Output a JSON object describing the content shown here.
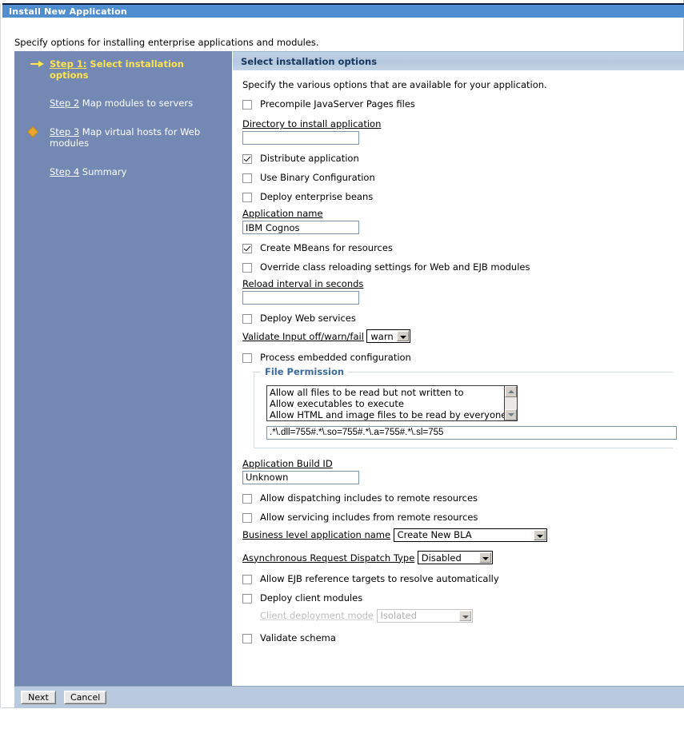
{
  "window": {
    "title": "Install New Application"
  },
  "intro": "Specify options for installing enterprise applications and modules.",
  "sidebar": {
    "steps": [
      {
        "label": "Step 1:",
        "text": " Select installation options",
        "marker": "arrow-right-icon",
        "state": "active"
      },
      {
        "label": "Step 2",
        "text": " Map modules to servers",
        "marker": "none",
        "state": "link"
      },
      {
        "label": "Step 3",
        "text": " Map virtual hosts for Web modules",
        "marker": "diamond-icon",
        "state": "link"
      },
      {
        "label": "Step 4",
        "text": " Summary",
        "marker": "none",
        "state": "link"
      }
    ]
  },
  "content": {
    "header": "Select installation options",
    "description": "Specify the various options that are available for your application.",
    "options": {
      "precompile_jsp": "Precompile JavaServer Pages files",
      "directory_label": "Directory to install application",
      "directory_value": "",
      "distribute_application": "Distribute application",
      "use_binary_configuration": "Use Binary Configuration",
      "deploy_enterprise_beans": "Deploy enterprise beans",
      "application_name_label": "Application name",
      "application_name_value": "IBM Cognos",
      "create_mbeans": "Create MBeans for resources",
      "override_class_reloading": "Override class reloading settings for Web and EJB modules",
      "reload_interval_label": "Reload interval in seconds",
      "reload_interval_value": "",
      "deploy_web_services": "Deploy Web services",
      "validate_input_label": "Validate Input off/warn/fail",
      "validate_input_value": "warn",
      "process_embedded_configuration": "Process embedded configuration",
      "application_build_id_label": "Application Build ID",
      "application_build_id_value": "Unknown",
      "allow_dispatching_includes": "Allow dispatching includes to remote resources",
      "allow_servicing_includes": "Allow servicing includes from remote resources",
      "bla_name_label": "Business level application name",
      "bla_name_value": "Create New BLA",
      "ard_type_label": "Asynchronous Request Dispatch Type",
      "ard_type_value": "Disabled",
      "allow_ejb_reference_targets": "Allow EJB reference targets to resolve automatically",
      "deploy_client_modules": "Deploy client modules",
      "client_deployment_mode_label": "Client deployment mode",
      "client_deployment_mode_value": "Isolated",
      "validate_schema": "Validate schema"
    },
    "file_permission": {
      "legend": "File Permission",
      "list_items": [
        "Allow all files to be read but not written to",
        "Allow executables to execute",
        "Allow HTML and image files to be read by everyone"
      ],
      "value": ".*\\.dll=755#.*\\.so=755#.*\\.a=755#.*\\.sl=755"
    }
  },
  "footer": {
    "next": "Next",
    "cancel": "Cancel"
  },
  "colors": {
    "titlebar": "#4f8fd0",
    "sidebar": "#7389b4",
    "header_bar": "#b6c9de",
    "footer_bar": "#b9cadf",
    "active_step": "#ffe34d",
    "diamond": "#e8a72c",
    "legend": "#3c6a9b"
  }
}
